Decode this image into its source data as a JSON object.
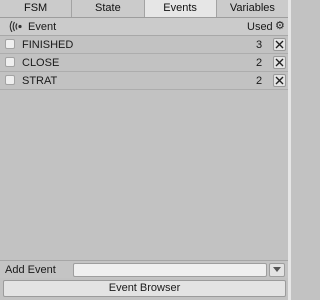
{
  "tabs": [
    {
      "label": "FSM",
      "active": false
    },
    {
      "label": "State",
      "active": false
    },
    {
      "label": "Events",
      "active": true
    },
    {
      "label": "Variables",
      "active": false
    }
  ],
  "header": {
    "event_label": "Event",
    "used_label": "Used",
    "event_icon": "broadcast-icon",
    "settings_icon": "gear-icon"
  },
  "events": [
    {
      "name": "FINISHED",
      "used": "3",
      "checked": false
    },
    {
      "name": "CLOSE",
      "used": "2",
      "checked": false
    },
    {
      "name": "STRAT",
      "used": "2",
      "checked": false
    }
  ],
  "add_event": {
    "label": "Add Event",
    "value": "",
    "dropdown_icon": "chevron-down-icon"
  },
  "event_browser_label": "Event Browser"
}
